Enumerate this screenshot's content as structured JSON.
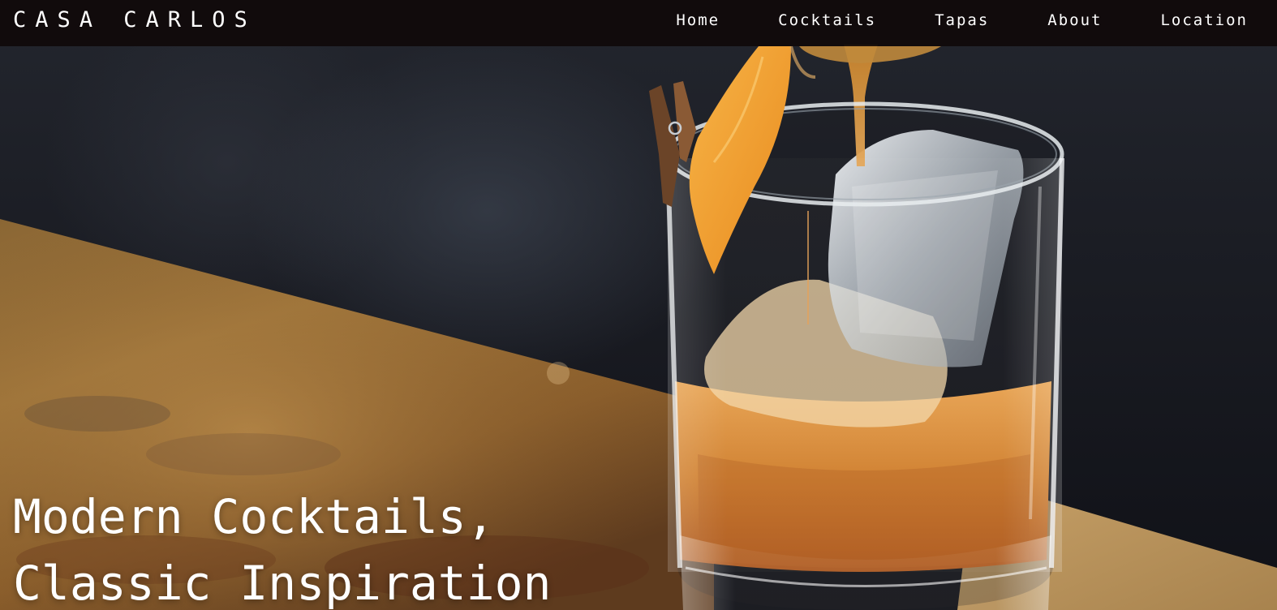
{
  "brand": {
    "name": "CASA CARLOS"
  },
  "nav": {
    "items": [
      {
        "label": "Home"
      },
      {
        "label": "Cocktails"
      },
      {
        "label": "Tapas"
      },
      {
        "label": "About"
      },
      {
        "label": "Location"
      }
    ]
  },
  "hero": {
    "headline_line1": "Modern Cocktails,",
    "headline_line2": "Classic Inspiration",
    "image": "cocktail-photo"
  },
  "colors": {
    "navbar_bg": "#100a0a",
    "text": "#ffffff",
    "bar_wood": "#a67a3c",
    "whiskey": "#c8731e",
    "orange_peel": "#f2a23a"
  }
}
